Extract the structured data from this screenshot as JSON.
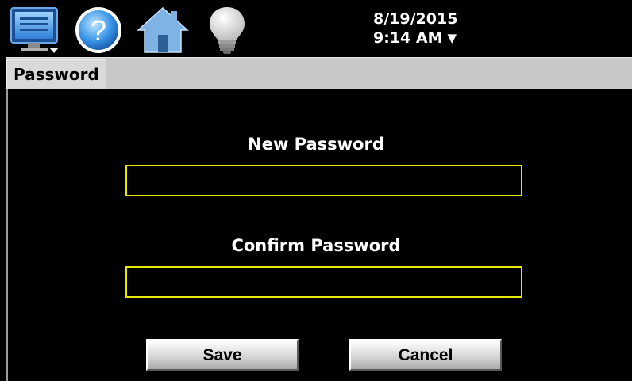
{
  "toolbar": {
    "icons": [
      {
        "name": "monitor-menu-icon"
      },
      {
        "name": "help-icon",
        "glyph": "?"
      },
      {
        "name": "home-icon"
      },
      {
        "name": "lightbulb-icon"
      }
    ],
    "date": "8/19/2015",
    "time": "9:14 AM",
    "dropdown_glyph": "▼"
  },
  "tabs": [
    {
      "label": "Password",
      "active": true
    }
  ],
  "form": {
    "new_password": {
      "label": "New Password",
      "value": "",
      "placeholder": ""
    },
    "confirm_password": {
      "label": "Confirm Password",
      "value": "",
      "placeholder": ""
    }
  },
  "buttons": {
    "save": "Save",
    "cancel": "Cancel"
  },
  "colors": {
    "background": "#000000",
    "input_border": "#e8e800",
    "tab_strip": "#c8c8c8",
    "text": "#ffffff"
  }
}
